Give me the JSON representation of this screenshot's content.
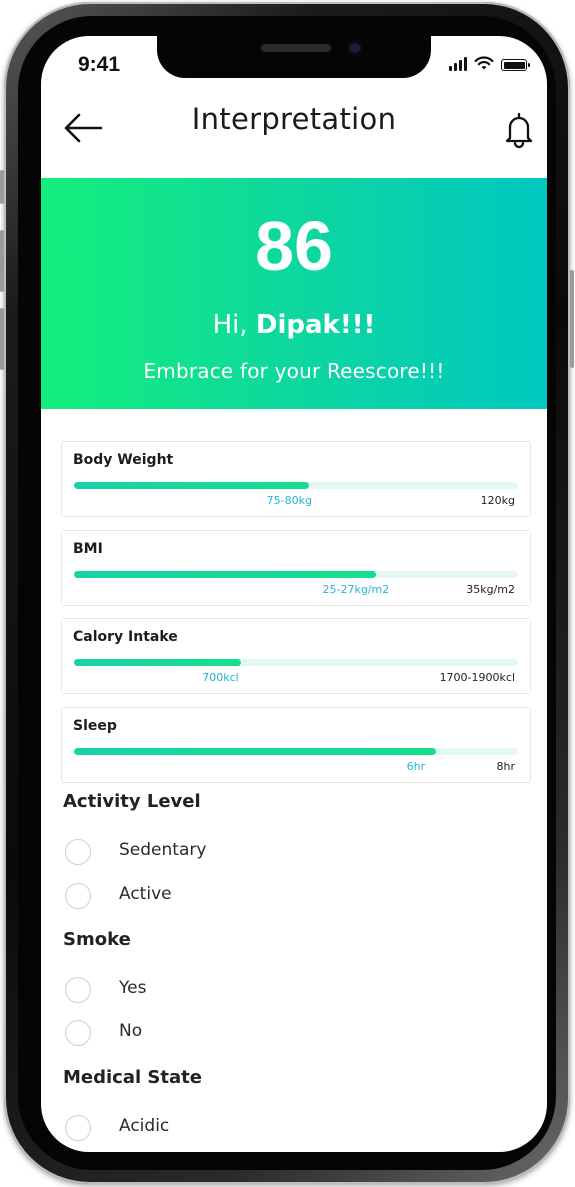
{
  "status_bar": {
    "time": "9:41"
  },
  "header": {
    "title": "Interpretation",
    "back_icon": "arrow-left-icon",
    "notification_icon": "bell-icon"
  },
  "hero": {
    "score": "86",
    "greeting_prefix": "Hi, ",
    "user_name": "Dipak!!!",
    "message": "Embrace for your Reescore!!!",
    "gradient_colors": [
      "#14ee7c",
      "#00c8c0"
    ]
  },
  "metrics": [
    {
      "title": "Body Weight",
      "current": "75-80kg",
      "max": "120kg",
      "progress": 0.53
    },
    {
      "title": "BMI",
      "current": "25-27kg/m2",
      "max": "35kg/m2",
      "progress": 0.68
    },
    {
      "title": "Calory Intake",
      "current": "700kcl",
      "max": "1700-1900kcl",
      "progress": 0.375
    },
    {
      "title": "Sleep",
      "current": "6hr",
      "max": "8hr",
      "progress": 0.815
    }
  ],
  "sections": {
    "activity": {
      "title": "Activity Level",
      "options": [
        "Sedentary",
        "Active"
      ]
    },
    "smoke": {
      "title": "Smoke",
      "options": [
        "Yes",
        "No"
      ]
    },
    "medical": {
      "title": "Medical State",
      "options": [
        "Acidic"
      ]
    }
  },
  "colors": {
    "accent": "#13e08c",
    "value_label": "#1fb7d6",
    "track": "#e3f8f4"
  }
}
